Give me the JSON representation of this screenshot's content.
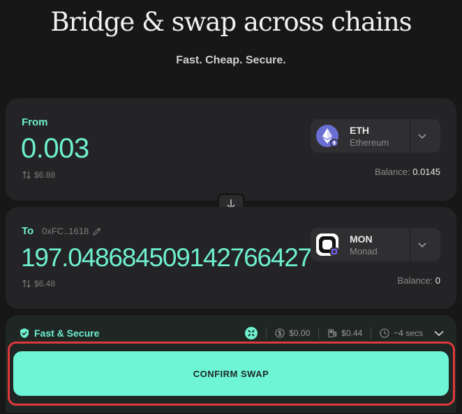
{
  "hero": {
    "title": "Bridge & swap across chains",
    "subtitle": "Fast. Cheap. Secure."
  },
  "from": {
    "label": "From",
    "amount": "0.003",
    "usd": "$6.88",
    "token": {
      "symbol": "ETH",
      "network": "Ethereum",
      "icon": "ethereum-icon"
    },
    "balance_label": "Balance:",
    "balance_value": "0.0145"
  },
  "to": {
    "label": "To",
    "address": "0xFC..1618",
    "amount": "197.048684509142766427",
    "usd": "$6.48",
    "token": {
      "symbol": "MON",
      "network": "Monad",
      "icon": "monad-icon"
    },
    "balance_label": "Balance:",
    "balance_value": "0"
  },
  "route": {
    "name": "Fast & Secure",
    "gas_fee": "$0.00",
    "network_fee": "$0.44",
    "time": "~4 secs"
  },
  "confirm_label": "CONFIRM SWAP",
  "colors": {
    "accent": "#6ef0cf",
    "button": "#6ef5d6",
    "background": "#171717",
    "card": "#242426",
    "highlight": "#e0393c"
  }
}
